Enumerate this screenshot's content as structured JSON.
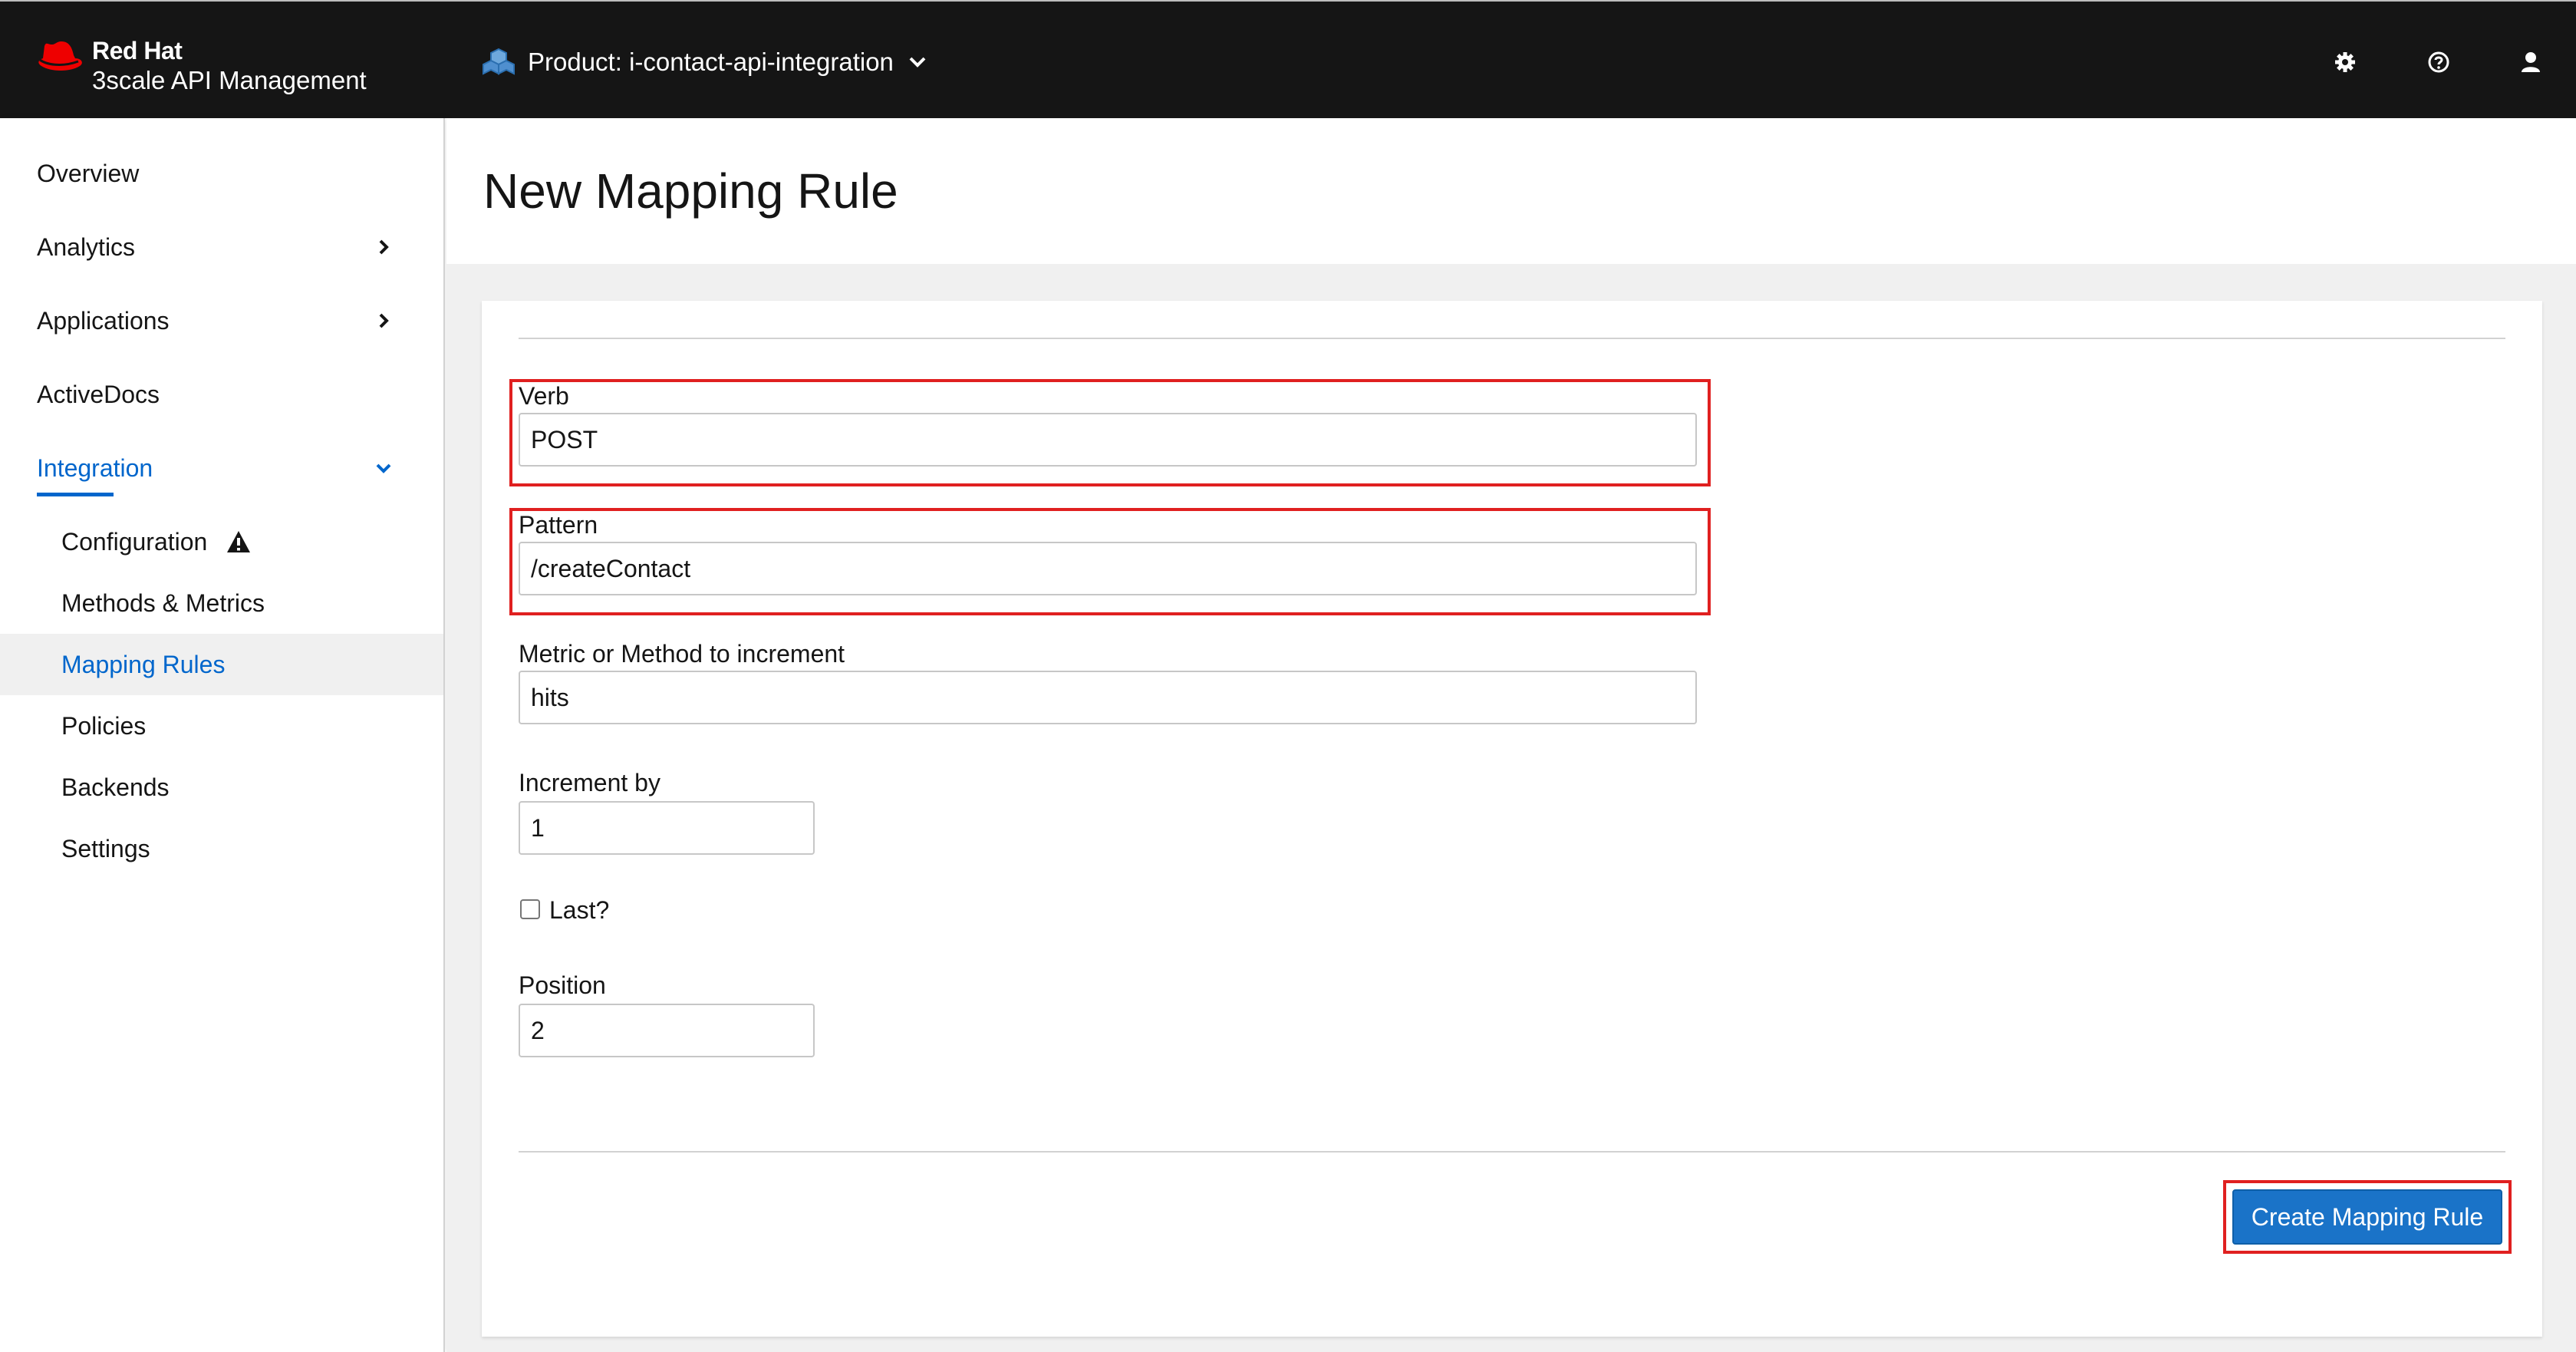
{
  "header": {
    "brand_name": "Red Hat",
    "brand_product": "3scale API Management",
    "context_label": "Product: i-contact-api-integration",
    "icons": [
      "gear-icon",
      "help-icon",
      "user-icon"
    ]
  },
  "sidebar": {
    "items": [
      {
        "label": "Overview"
      },
      {
        "label": "Analytics"
      },
      {
        "label": "Applications"
      },
      {
        "label": "ActiveDocs"
      },
      {
        "label": "Integration"
      }
    ],
    "subitems": [
      {
        "label": "Configuration"
      },
      {
        "label": "Methods & Metrics"
      },
      {
        "label": "Mapping Rules"
      },
      {
        "label": "Policies"
      },
      {
        "label": "Backends"
      },
      {
        "label": "Settings"
      }
    ]
  },
  "page": {
    "title": "New Mapping Rule"
  },
  "form": {
    "verb_label": "Verb",
    "verb_value": "POST",
    "pattern_label": "Pattern",
    "pattern_value": "/createContact",
    "metric_label": "Metric or Method to increment",
    "metric_value": "hits",
    "increment_label": "Increment by",
    "increment_value": "1",
    "last_label": "Last?",
    "last_checked": false,
    "position_label": "Position",
    "position_value": "2",
    "submit_label": "Create Mapping Rule"
  },
  "colors": {
    "masthead": "#151515",
    "accent": "#0066cc",
    "brand_red": "#ee0000",
    "highlight": "#e02020",
    "button": "#1a73c8"
  }
}
